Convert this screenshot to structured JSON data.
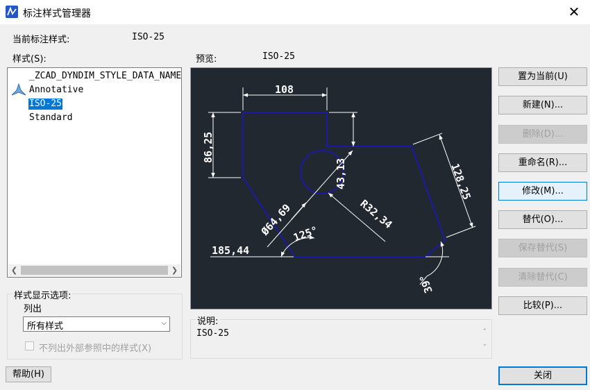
{
  "window": {
    "title": "标注样式管理器",
    "close_glyph": "✕"
  },
  "current_style": {
    "label": "当前标注样式:",
    "value": "ISO-25"
  },
  "styles": {
    "label": "样式(S):",
    "items": [
      "_ZCAD_DYNDIM_STYLE_DATA_NAME",
      "Annotative",
      "ISO-25",
      "Standard"
    ],
    "selected": "ISO-25",
    "annotative_icon": "annotative-scale-icon"
  },
  "preview": {
    "label": "预览:",
    "style_name": "ISO-25",
    "dimensions": {
      "top_width": "108",
      "left_height": "86,25",
      "diagonal": "128,25",
      "vertical_small": "43,13",
      "radius": "R32,34",
      "diameter": "Ø64,69",
      "angle_125": "125°",
      "bottom_left": "185,44",
      "angle_39": "39°"
    },
    "colors": {
      "background": "#212830",
      "outline": "#1a1aa6",
      "dimension": "#ffffff"
    }
  },
  "display_options": {
    "group_label": "样式显示选项:",
    "list_label": "列出",
    "list_value": "所有样式",
    "exclude_xref_label": "不列出外部参照中的样式(X)",
    "exclude_xref_checked": false
  },
  "description": {
    "label": "说明:",
    "text": "ISO-25"
  },
  "buttons": {
    "set_current": "置为当前(U)",
    "new": "新建(N)...",
    "delete": "删除(D)...",
    "rename": "重命名(R)...",
    "modify": "修改(M)...",
    "override": "替代(O)...",
    "save_override": "保存替代(S)",
    "clear_override": "清除替代(C)",
    "compare": "比较(P)...",
    "help": "帮助(H)",
    "close": "关闭"
  },
  "colors": {
    "accent": "#0078d7",
    "selection": "#0078d7",
    "disabled_text": "#a0a0a0"
  }
}
